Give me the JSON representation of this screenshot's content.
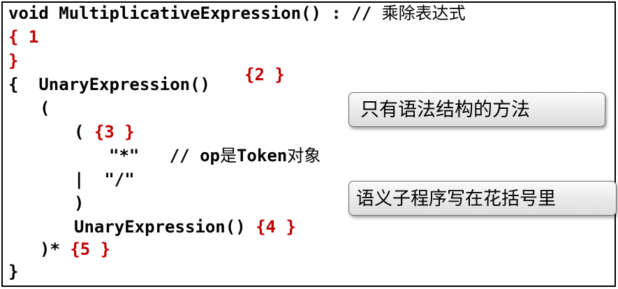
{
  "code": {
    "l1_sig": "void MultiplicativeExpression() : //",
    "l1_comment": "乘除表达式",
    "l2_brace": "{",
    "l2_ann": "1",
    "l3_brace": "}",
    "l4_brace": "{",
    "l4_call": "UnaryExpression()",
    "l4_ann": "{2 }",
    "l5_paren": "(",
    "l6_paren": "(",
    "l6_ann": "{3 }",
    "l7_token": "\"*\"",
    "l7_comment_a": "// op",
    "l7_comment_b": "是",
    "l7_comment_c": "Token",
    "l7_comment_d": "对象",
    "l8_pipe": "|",
    "l8_token": "\"/\"",
    "l9_paren": ")",
    "l10_call": "UnaryExpression()",
    "l10_ann": "{4 }",
    "l11_close": ")*",
    "l11_ann": "{5 }",
    "l12_brace": "}"
  },
  "callouts": {
    "first": "只有语法结构的方法",
    "second": "语义子程序写在花括号里"
  },
  "colors": {
    "annotation": "#c00000",
    "text": "#000000"
  }
}
